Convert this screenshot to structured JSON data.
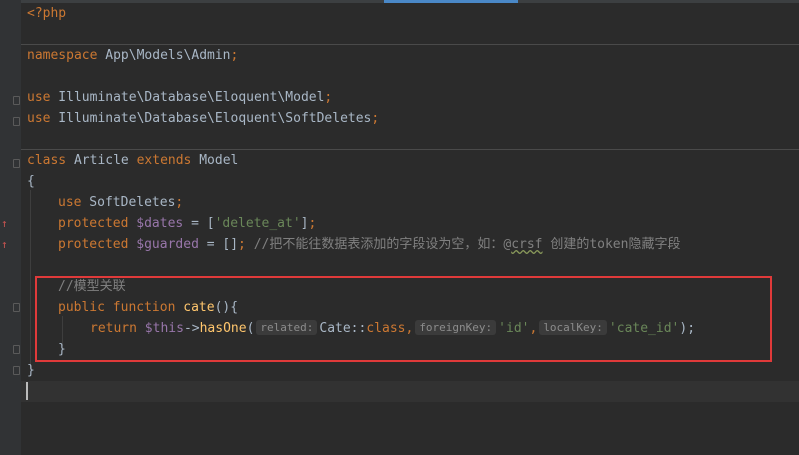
{
  "top_glyph_left": "",
  "top_glyph_right": "",
  "code": {
    "l1": {
      "text": "<?php"
    },
    "l3": {
      "ns_kw": "namespace",
      "ns_path": " App\\Models\\Admin",
      "semi": ";"
    },
    "l5": {
      "kw": "use",
      "path": " Illuminate\\Database\\Eloquent\\Model",
      "semi": ";"
    },
    "l6": {
      "kw": "use",
      "path": " Illuminate\\Database\\Eloquent\\SoftDeletes",
      "semi": ";"
    },
    "l8": {
      "kw_class": "class",
      "name": " Article ",
      "kw_extends": "extends",
      "parent": " Model"
    },
    "l9": {
      "text": "{"
    },
    "l10": {
      "kw": "use",
      "trait": " SoftDeletes",
      "semi": ";"
    },
    "l11": {
      "kw": "protected",
      "var": " $dates",
      "eq": " = [",
      "str": "'delete_at'",
      "end": "]",
      "semi": ";"
    },
    "l12": {
      "kw": "protected",
      "var": " $guarded",
      "eq": " = []",
      "semi": ";",
      "comment_pre": " //把不能往数据表添加的字段设为空，如：@",
      "comment_wavy": "crsf",
      "comment_post": " 创建的token隐藏字段"
    },
    "l14": {
      "comment": "//模型关联"
    },
    "l15": {
      "kw_public": "public",
      "kw_function": " function",
      "fn": " cate",
      "rest": "(){"
    },
    "l16": {
      "kw_return": "return",
      "this": " $this",
      "arrow": "->",
      "method": "hasOne",
      "paren": "(",
      "hint_related": "related:",
      "cls": "Cate::",
      "kw_class": "class",
      "comma1": ",",
      "hint_foreign": "foreignKey:",
      "str_id": "'id'",
      "comma2": ",",
      "hint_local": "localKey:",
      "str_cate_id": "'cate_id'",
      "close": ");"
    },
    "l17": {
      "text": "}"
    },
    "l18": {
      "text": "}"
    }
  },
  "gutter": {
    "override_marker": "↑"
  },
  "colors": {
    "background": "#2b2b2b",
    "keyword": "#cc7832",
    "string": "#6a8759",
    "variable": "#9876aa",
    "comment": "#808080",
    "function": "#ffc66d",
    "highlight_box": "#e03a3a"
  }
}
